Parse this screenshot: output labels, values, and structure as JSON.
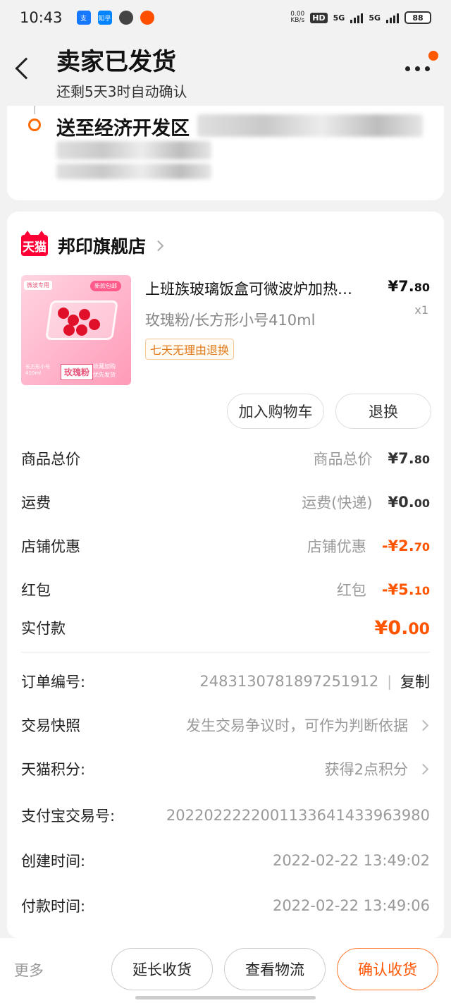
{
  "status": {
    "time": "10:43",
    "net_speed_value": "0.00",
    "net_speed_unit": "KB/s",
    "hd": "HD",
    "sim1": "5G",
    "sim2": "5G",
    "battery": "88",
    "apps": [
      "zhifubao-icon",
      "zhihu-icon",
      "chat-icon",
      "taobao-icon"
    ],
    "zhihu_label": "知乎",
    "alipay_label": "支"
  },
  "header": {
    "title": "卖家已发货",
    "subtitle": "还剩5天3时自动确认"
  },
  "address": {
    "text": "送至经济开发区"
  },
  "shop": {
    "logo_text": "天猫",
    "name": "邦印旗舰店"
  },
  "product": {
    "title": "上班族玻璃饭盒可微波炉加热…",
    "price_int": "¥7.",
    "price_dec": "80",
    "qty": "x1",
    "spec": "玫瑰粉/长方形小号410ml",
    "badge": "七天无理由退换",
    "img_tag_left": "微波专用",
    "img_tag_right": "新款包邮",
    "img_label": "玫瑰粉",
    "img_small": "长方形小号\n410ml",
    "img_red": "收藏加购\n优先发货"
  },
  "actions": {
    "add_cart": "加入购物车",
    "return": "退换"
  },
  "prices": {
    "goods_total_label": "商品总价",
    "goods_total_mid": "商品总价",
    "goods_total_int": "¥7.",
    "goods_total_dec": "80",
    "shipping_label": "运费",
    "shipping_mid": "运费(快递)",
    "shipping_int": "¥0.",
    "shipping_dec": "00",
    "shop_discount_label": "店铺优惠",
    "shop_discount_mid": "店铺优惠",
    "shop_discount_int": "-¥2.",
    "shop_discount_dec": "70",
    "red_packet_label": "红包",
    "red_packet_mid": "红包",
    "red_packet_int": "-¥5.",
    "red_packet_dec": "10",
    "paid_label": "实付款",
    "paid_int": "¥0.",
    "paid_dec": "00"
  },
  "order": {
    "order_no_label": "订单编号:",
    "order_no": "2483130781897251912",
    "sep": "|",
    "copy": "复制",
    "snapshot_label": "交易快照",
    "snapshot_value": "发生交易争议时，可作为判断依据",
    "points_label": "天猫积分:",
    "points_value": "获得2点积分",
    "alipay_label": "支付宝交易号:",
    "alipay_no": "2022022222001133641433963980",
    "created_label": "创建时间:",
    "created": "2022-02-22 13:49:02",
    "paid_time_label": "付款时间:",
    "paid_time": "2022-02-22 13:49:06"
  },
  "bottom": {
    "more": "更多",
    "extend": "延长收货",
    "logistics": "查看物流",
    "confirm": "确认收货"
  },
  "colors": {
    "accent": "#ff5500",
    "tmall_red": "#ff0036",
    "background": "#f2f2f2"
  }
}
